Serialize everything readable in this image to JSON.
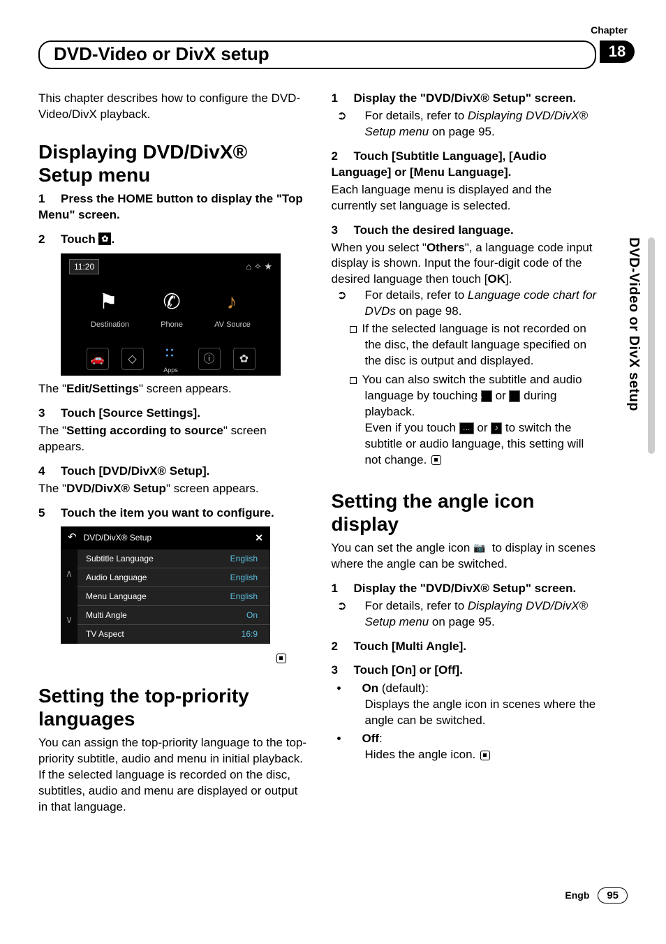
{
  "header": {
    "chapter_label": "Chapter",
    "chapter_number": "18",
    "title": "DVD-Video or DivX setup",
    "side_tab": "DVD-Video or DivX setup"
  },
  "left": {
    "intro": "This chapter describes how to configure the DVD-Video/DivX playback.",
    "h1": "Displaying DVD/DivX® Setup menu",
    "s1_num": "1",
    "s1": "Press the HOME button to display the \"Top Menu\" screen.",
    "s2_num": "2",
    "s2a": "Touch ",
    "s2b": ".",
    "ss1": {
      "time": "11:20",
      "dest": "Destination",
      "phone": "Phone",
      "av": "AV Source",
      "apps": "Apps"
    },
    "after_ss1_a": "The \"",
    "after_ss1_b": "Edit/Settings",
    "after_ss1_c": "\" screen appears.",
    "s3_num": "3",
    "s3": "Touch [Source Settings].",
    "s3_sub_a": "The \"",
    "s3_sub_b": "Setting according to source",
    "s3_sub_c": "\" screen appears.",
    "s4_num": "4",
    "s4": "Touch [DVD/DivX® Setup].",
    "s4_sub_a": "The \"",
    "s4_sub_b": "DVD/DivX® Setup",
    "s4_sub_c": "\" screen appears.",
    "s5_num": "5",
    "s5": "Touch the item you want to configure.",
    "ss2": {
      "title": "DVD/DivX® Setup",
      "rows": [
        {
          "l": "Subtitle Language",
          "v": "English"
        },
        {
          "l": "Audio Language",
          "v": "English"
        },
        {
          "l": "Menu Language",
          "v": "English"
        },
        {
          "l": "Multi Angle",
          "v": "On"
        },
        {
          "l": "TV Aspect",
          "v": "16:9"
        }
      ]
    },
    "h2": "Setting the top-priority languages",
    "h2_body": "You can assign the top-priority language to the top-priority subtitle, audio and menu in initial playback. If the selected language is recorded on the disc, subtitles, audio and menu are displayed or output in that language."
  },
  "right": {
    "r1_num": "1",
    "r1": "Display the \"DVD/DivX® Setup\" screen.",
    "r1_sub_a": "For details, refer to ",
    "r1_sub_b": "Displaying DVD/DivX® Setup menu",
    "r1_sub_c": " on page 95.",
    "r2_num": "2",
    "r2": "Touch [Subtitle Language], [Audio Language] or [Menu Language].",
    "r2_body": "Each language menu is displayed and the currently set language is selected.",
    "r3_num": "3",
    "r3": "Touch the desired language.",
    "r3_body_a": "When you select \"",
    "r3_body_b": "Others",
    "r3_body_c": "\", a language code input display is shown. Input the four-digit code of the desired language then touch [",
    "r3_body_d": "OK",
    "r3_body_e": "].",
    "r3_bullet1_a": "For details, refer to ",
    "r3_bullet1_b": "Language code chart for DVDs",
    "r3_bullet1_c": " on page 98.",
    "r3_box1": "If the selected language is not recorded on the disc, the default language specified on the disc is output and displayed.",
    "r3_box2_a": "You can also switch the subtitle and audio language by touching ",
    "r3_box2_b": " or ",
    "r3_box2_c": " during playback.",
    "r3_box2_d": "Even if you touch ",
    "r3_box2_e": " or ",
    "r3_box2_f": " to switch the subtitle or audio language, this setting will not change.",
    "h3": "Setting the angle icon display",
    "h3_intro_a": "You can set the angle icon ",
    "h3_intro_b": " to display in scenes where the angle can be switched.",
    "a1_num": "1",
    "a1": "Display the \"DVD/DivX® Setup\" screen.",
    "a1_sub_a": "For details, refer to ",
    "a1_sub_b": "Displaying DVD/DivX® Setup menu",
    "a1_sub_c": " on page 95.",
    "a2_num": "2",
    "a2": "Touch [Multi Angle].",
    "a3_num": "3",
    "a3": "Touch [On] or [Off].",
    "a3_on": "On",
    "a3_on_tail": " (default):",
    "a3_on_body": "Displays the angle icon in scenes where the angle can be switched.",
    "a3_off": "Off",
    "a3_off_tail": ":",
    "a3_off_body": "Hides the angle icon."
  },
  "footer": {
    "lang": "Engb",
    "page": "95"
  }
}
